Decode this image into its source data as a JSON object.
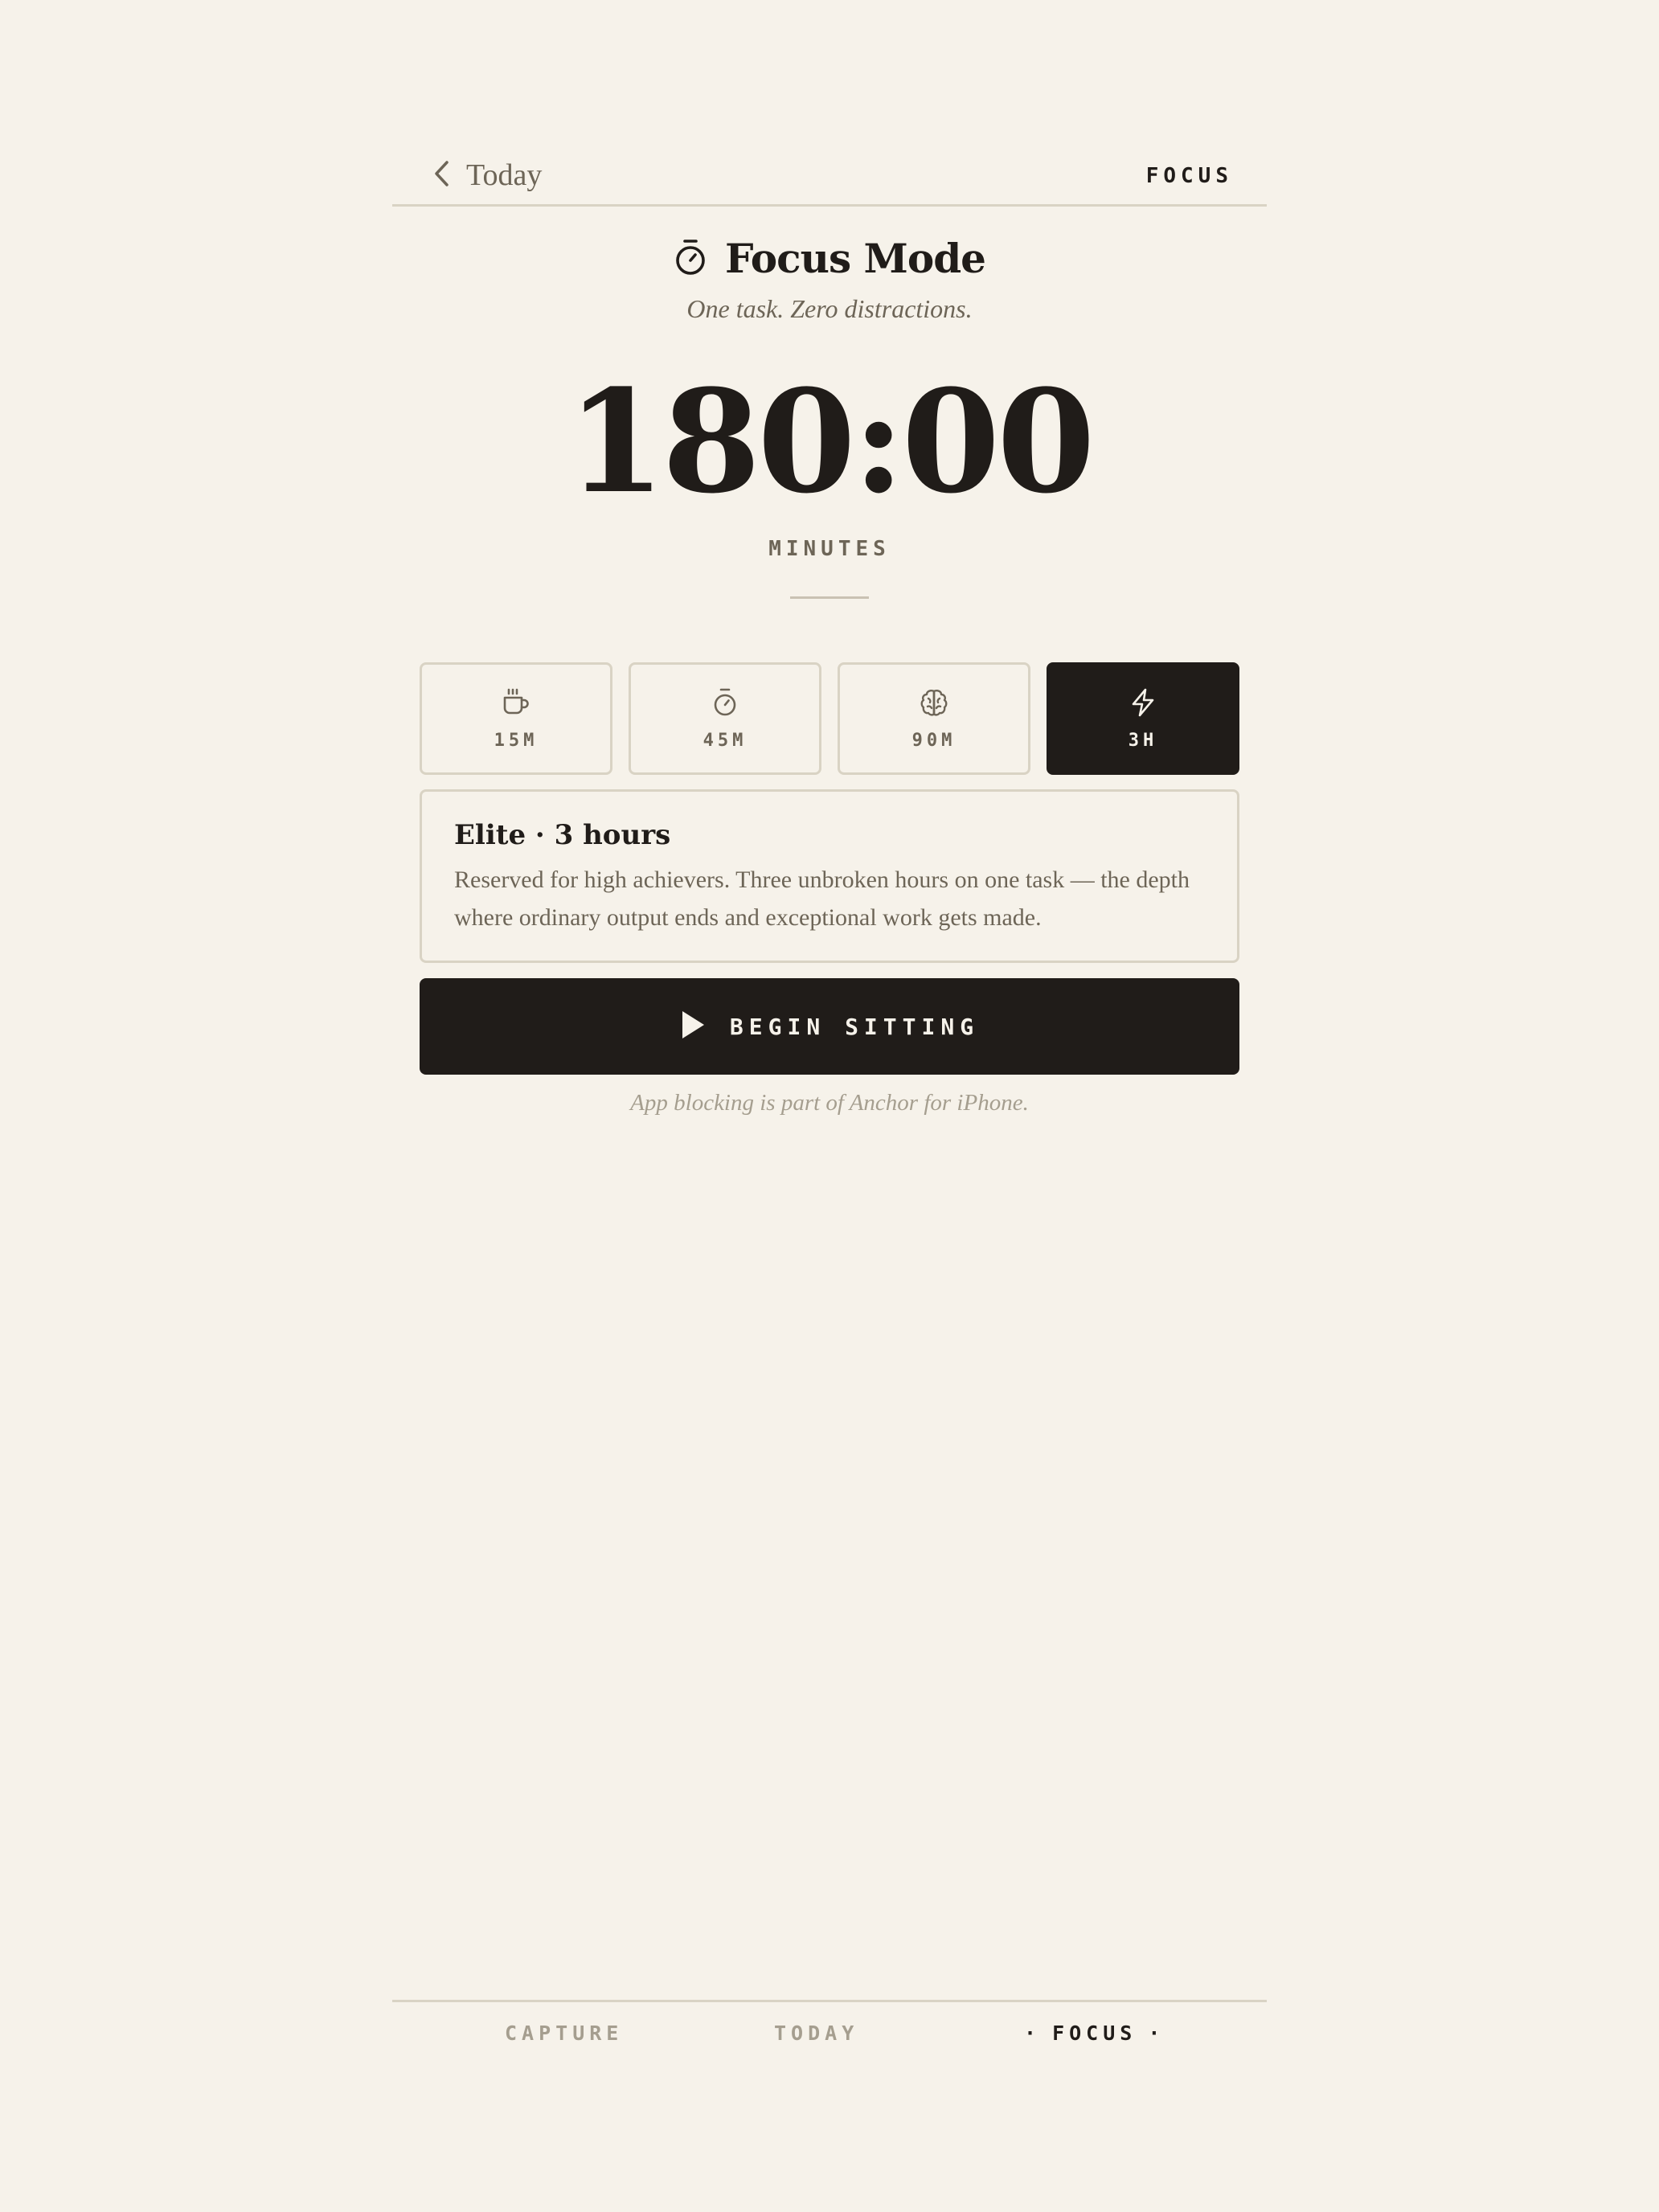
{
  "topbar": {
    "back_label": "Today",
    "tag": "FOCUS"
  },
  "heading": {
    "icon": "stopwatch-icon",
    "title": "Focus Mode",
    "subtitle": "One task. Zero distractions."
  },
  "timer": {
    "value": "180:00",
    "unit": "MINUTES"
  },
  "presets": [
    {
      "icon": "coffee-cup-icon",
      "label": "15M",
      "active": false
    },
    {
      "icon": "stopwatch-icon",
      "label": "45M",
      "active": false
    },
    {
      "icon": "brain-icon",
      "label": "90M",
      "active": false
    },
    {
      "icon": "lightning-icon",
      "label": "3H",
      "active": true
    }
  ],
  "card": {
    "title": "Elite · 3 hours",
    "body": "Reserved for high achievers. Three unbroken hours on one task — the depth where ordinary output ends and exceptional work gets made."
  },
  "begin_button": {
    "icon": "play-icon",
    "label": "BEGIN SITTING"
  },
  "note": "App blocking is part of Anchor for iPhone.",
  "bottom_nav": {
    "items": [
      {
        "label": "CAPTURE",
        "active": false
      },
      {
        "label": "TODAY",
        "active": false
      },
      {
        "label": "FOCUS",
        "active": true
      }
    ],
    "active_marker": "·"
  },
  "colors": {
    "background": "#f6f2ea",
    "ink": "#201c19",
    "muted": "#6d6557",
    "faint": "#a59e8f",
    "border": "#d9d3c4"
  }
}
